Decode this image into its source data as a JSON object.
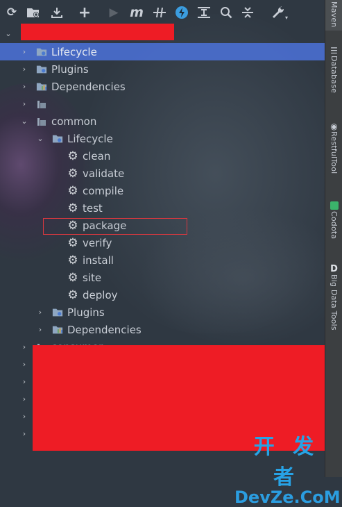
{
  "toolbar": {
    "icons": [
      "refresh-icon",
      "generate-sources-icon",
      "download-icon",
      "add-icon",
      "run-icon",
      "execute-goal-icon",
      "toggle-offline-icon",
      "skip-tests-icon",
      "show-dependencies-icon",
      "find-icon",
      "collapse-all-icon",
      "settings-wrench-icon"
    ]
  },
  "sidebar": {
    "tabs": [
      {
        "label": "Maven",
        "icon": "maven-icon"
      },
      {
        "label": "Database",
        "icon": "database-icon"
      },
      {
        "label": "RestfulTool",
        "icon": "restful-icon"
      },
      {
        "label": "Codota",
        "icon": "codota-icon"
      },
      {
        "label": "Big Data Tools",
        "icon": "bigdata-icon"
      }
    ]
  },
  "tree": {
    "root_lifecycle": "Lifecycle",
    "root_plugins": "Plugins",
    "root_dependencies": "Dependencies",
    "module": "common",
    "lifecycle": "Lifecycle",
    "phases": [
      "clean",
      "validate",
      "compile",
      "test",
      "package",
      "verify",
      "install",
      "site",
      "deploy"
    ],
    "plugins": "Plugins",
    "dependencies": "Dependencies",
    "partial_module": "consumer"
  },
  "watermark": {
    "cn": "开 发 者",
    "en": "DevZe.CoM"
  },
  "colors": {
    "selection": "#4a6fd1",
    "redaction": "#ee1c25",
    "highlight_border": "#d9383f"
  }
}
